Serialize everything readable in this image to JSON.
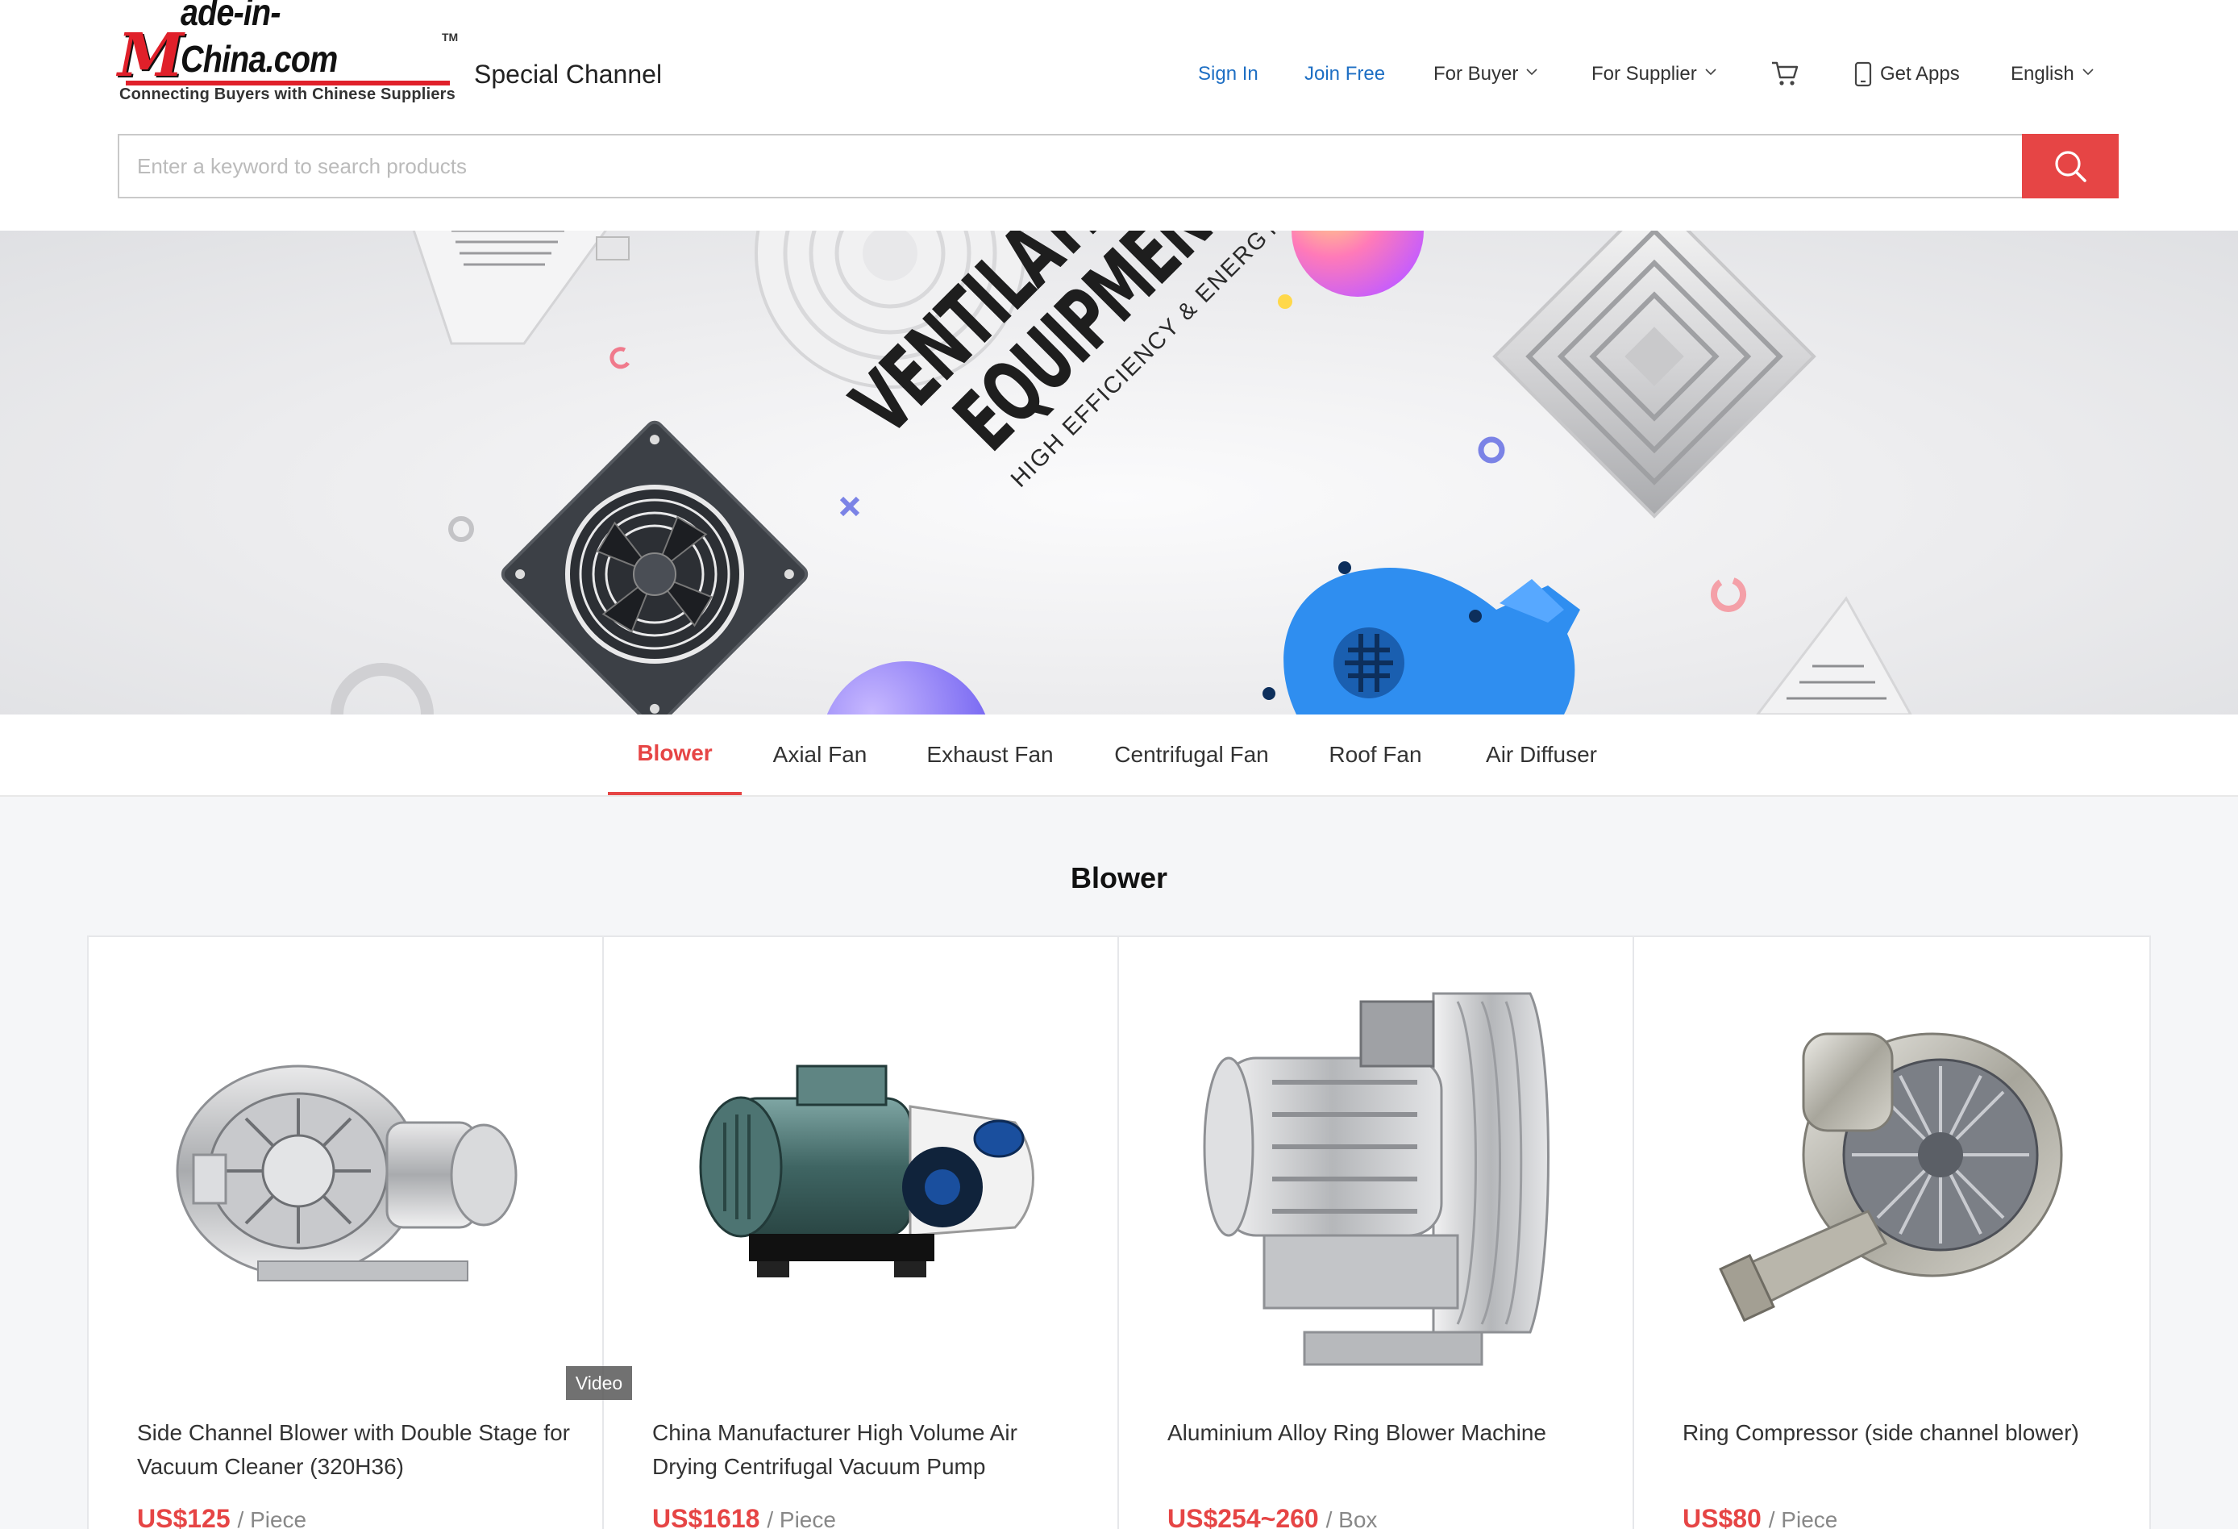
{
  "header": {
    "logo_text": "Made-in-China.com",
    "logo_m": "M",
    "logo_rest": "ade-in-China.com",
    "logo_tm": "TM",
    "logo_tagline": "Connecting Buyers with Chinese Suppliers",
    "channel_title": "Special Channel",
    "nav": {
      "sign_in": "Sign In",
      "join_free": "Join Free",
      "for_buyer": "For Buyer",
      "for_supplier": "For Supplier",
      "get_apps": "Get Apps",
      "language": "English"
    },
    "search": {
      "placeholder": "Enter a keyword to search products",
      "value": ""
    }
  },
  "banner": {
    "title_line1": "VENTILATION",
    "title_line2": "EQUIPMENT",
    "subtitle": "HIGH EFFICIENCY & ENERGY SAVING"
  },
  "tabs": [
    {
      "label": "Blower",
      "active": true
    },
    {
      "label": "Axial Fan",
      "active": false
    },
    {
      "label": "Exhaust Fan",
      "active": false
    },
    {
      "label": "Centrifugal Fan",
      "active": false
    },
    {
      "label": "Roof Fan",
      "active": false
    },
    {
      "label": "Air Diffuser",
      "active": false
    }
  ],
  "section": {
    "title": "Blower"
  },
  "products": [
    {
      "title": "Side Channel Blower with Double Stage for Vacuum Cleaner (320H36)",
      "price": "US$125",
      "unit": "/ Piece",
      "video": false
    },
    {
      "title": "China Manufacturer High Volume Air Drying Centrifugal Vacuum Pump",
      "price": "US$1618",
      "unit": "/ Piece",
      "video": true,
      "video_label": "Video"
    },
    {
      "title": "Aluminium Alloy Ring Blower Machine",
      "price": "US$254~260",
      "unit": "/ Box",
      "video": false
    },
    {
      "title": "Ring Compressor (side channel blower)",
      "price": "US$80",
      "unit": "/ Piece",
      "video": false
    }
  ],
  "colors": {
    "accent": "#e64545",
    "link_blue": "#1e6fc4",
    "page_bg": "#f5f6f8",
    "logo_red": "#e0202a"
  },
  "icons": [
    "chevron-down-icon",
    "cart-icon",
    "phone-icon",
    "search-icon"
  ]
}
